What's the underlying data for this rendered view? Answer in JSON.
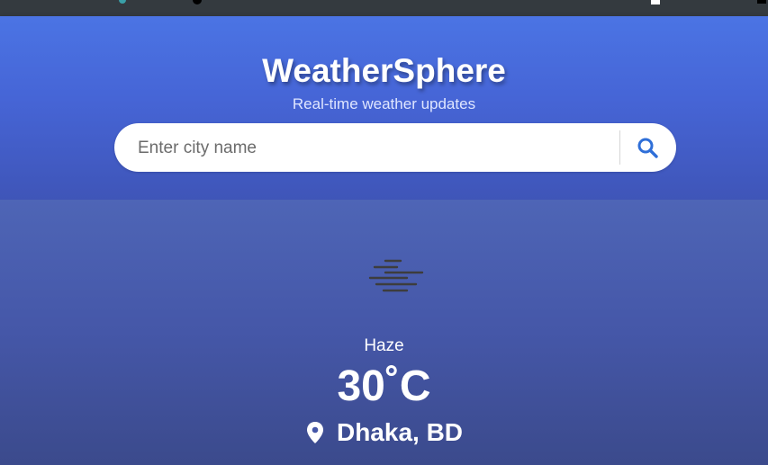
{
  "header": {
    "title": "WeatherSphere",
    "subtitle": "Real-time weather updates"
  },
  "search": {
    "placeholder": "Enter city name",
    "value": "",
    "button_icon": "search-icon"
  },
  "weather": {
    "icon": "haze-icon",
    "condition": "Haze",
    "temperature": "30˚C",
    "location_icon": "location-pin-icon",
    "location": "Dhaka, BD"
  },
  "colors": {
    "header_top": "#4b74e4",
    "header_bottom": "#3f55b8",
    "main_top": "#4e65b6",
    "main_bottom": "#3b4a8c",
    "search_icon": "#2f6fd8",
    "browser_strip": "#343a3f"
  }
}
